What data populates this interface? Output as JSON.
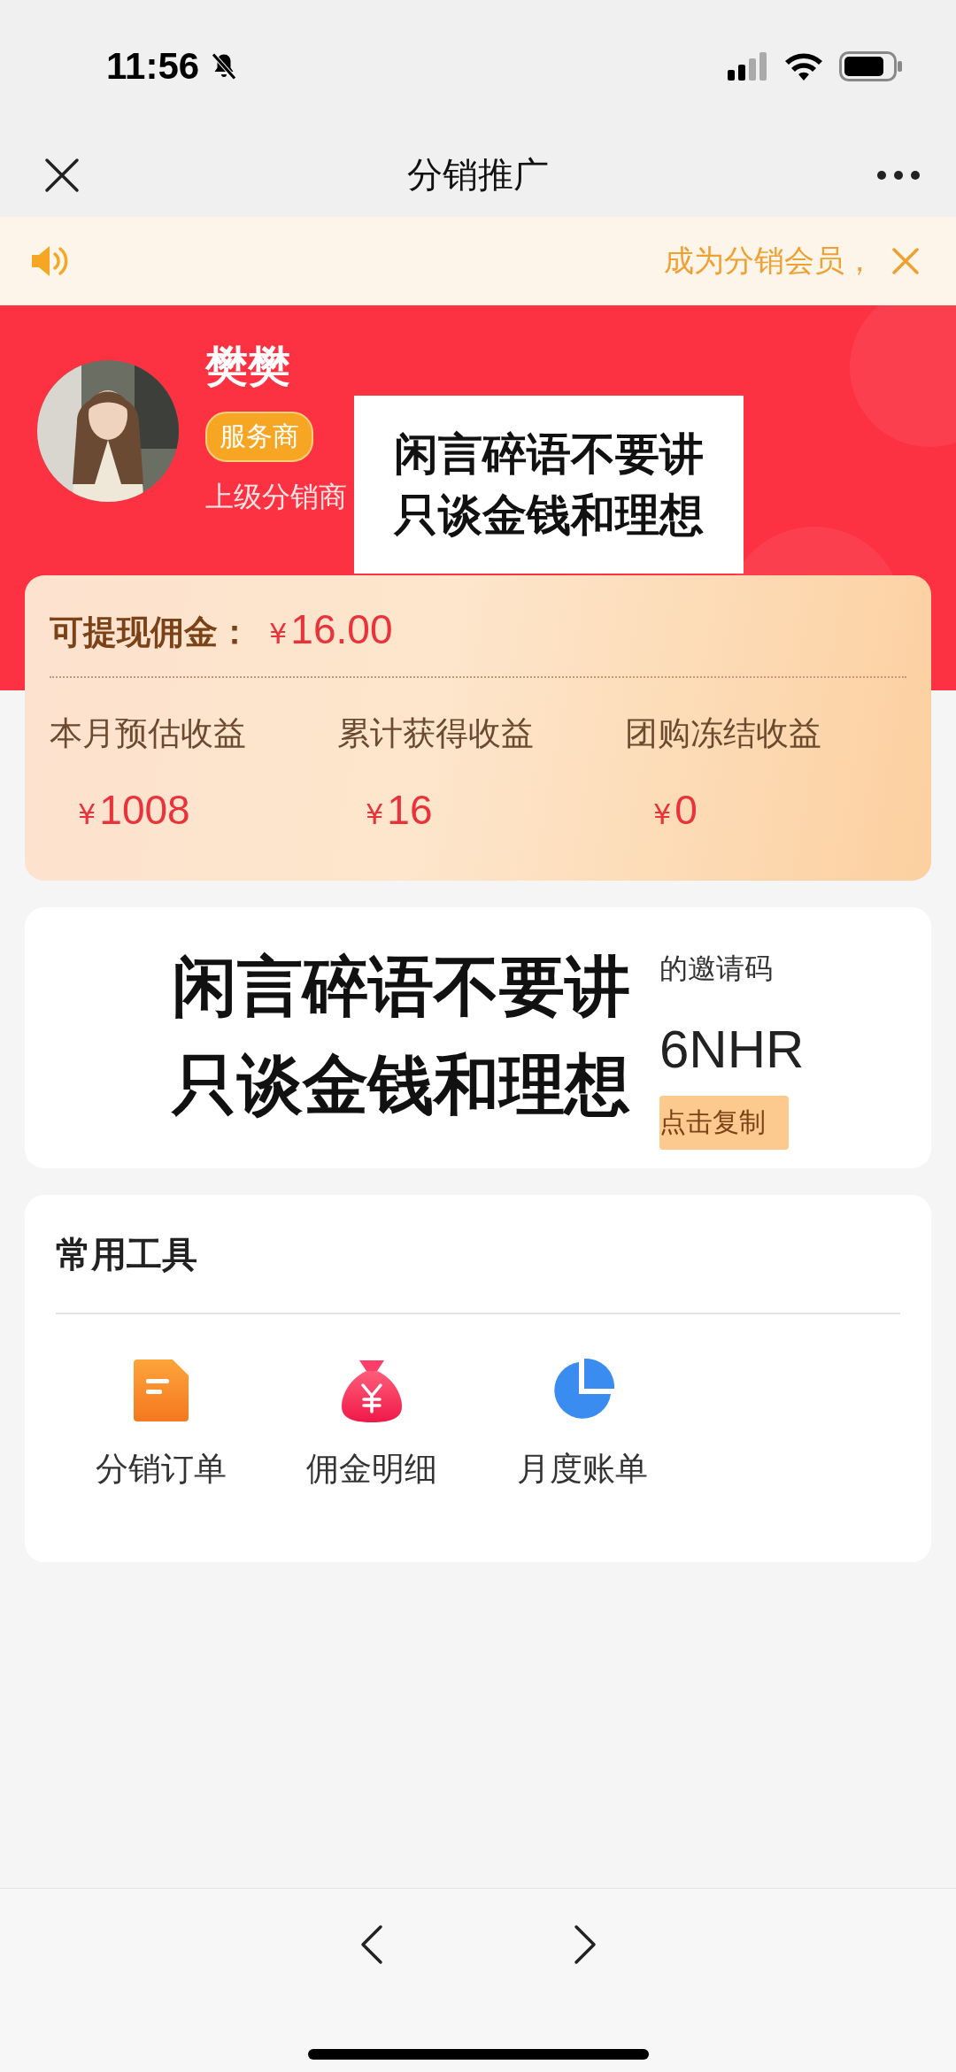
{
  "status_bar": {
    "time": "11:56"
  },
  "nav": {
    "title": "分销推广"
  },
  "notice": {
    "text": "成为分销会员，"
  },
  "profile": {
    "name": "樊樊",
    "badge": "服务商",
    "parent_label": "上级分销商"
  },
  "stickers": [
    {
      "lines": [
        "闲言碎语不要讲",
        "只谈金钱和理想"
      ]
    },
    {
      "lines": [
        "闲言碎语不要讲",
        "只谈金钱和理想"
      ]
    }
  ],
  "earnings": {
    "withdrawable_label": "可提现佣金：",
    "withdrawable_currency": "¥",
    "withdrawable_amount": "16.00",
    "stats": [
      {
        "label": "本月预估收益",
        "currency": "¥",
        "amount": "1008"
      },
      {
        "label": "累计获得收益",
        "currency": "¥",
        "amount": "16"
      },
      {
        "label": "团购冻结收益",
        "currency": "¥",
        "amount": "0"
      }
    ]
  },
  "invite": {
    "label": "的邀请码",
    "code": "6NHR",
    "copy_button": "点击复制"
  },
  "tools": {
    "title": "常用工具",
    "items": [
      {
        "label": "分销订单",
        "kind": "document"
      },
      {
        "label": "佣金明细",
        "kind": "money-bag"
      },
      {
        "label": "月度账单",
        "kind": "pie"
      }
    ]
  }
}
